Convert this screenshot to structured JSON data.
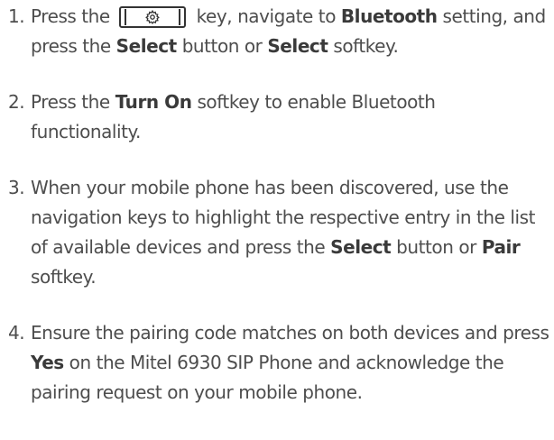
{
  "steps": [
    {
      "number": "1.",
      "segments": [
        {
          "text": "Press the ",
          "bold": false
        },
        {
          "key_icon": "gear-icon"
        },
        {
          "text": " key, navigate to ",
          "bold": false
        },
        {
          "text": "Bluetooth",
          "bold": true
        },
        {
          "text": " setting, and press the ",
          "bold": false
        },
        {
          "text": "Select",
          "bold": true
        },
        {
          "text": " button or ",
          "bold": false
        },
        {
          "text": "Select",
          "bold": true
        },
        {
          "text": " softkey.",
          "bold": false
        }
      ]
    },
    {
      "number": "2.",
      "segments": [
        {
          "text": "Press the ",
          "bold": false
        },
        {
          "text": "Turn On",
          "bold": true
        },
        {
          "text": " softkey to enable Bluetooth functionality.",
          "bold": false
        }
      ]
    },
    {
      "number": "3.",
      "segments": [
        {
          "text": "When your mobile phone has been discovered, use the navigation keys to highlight the respective entry in the list of available devices and press the ",
          "bold": false
        },
        {
          "text": "Select",
          "bold": true
        },
        {
          "text": " button or ",
          "bold": false
        },
        {
          "text": "Pair",
          "bold": true
        },
        {
          "text": " softkey.",
          "bold": false
        }
      ]
    },
    {
      "number": "4.",
      "segments": [
        {
          "text": "Ensure the pairing code matches on both devices and press ",
          "bold": false
        },
        {
          "text": "Yes",
          "bold": true
        },
        {
          "text": " on the Mitel 6930 SIP Phone and acknowledge the pairing request on your mobile phone.",
          "bold": false
        }
      ]
    }
  ],
  "colors": {
    "text": "#4d4d4d",
    "bold_text": "#3a3a3a",
    "key_outline": "#333333"
  }
}
